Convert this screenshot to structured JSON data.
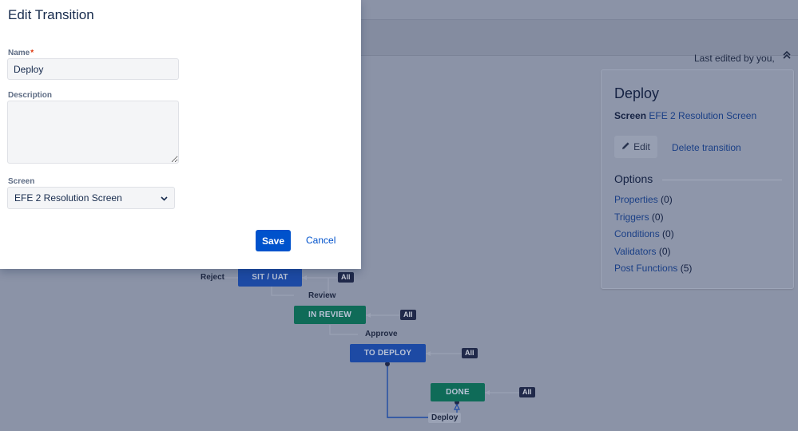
{
  "header": {
    "last_edited": "Last edited by you,"
  },
  "dialog": {
    "title": "Edit Transition",
    "name_label": "Name",
    "required_marker": "*",
    "name_value": "Deploy",
    "description_label": "Description",
    "description_value": "",
    "screen_label": "Screen",
    "screen_value": "EFE 2 Resolution Screen",
    "save_label": "Save",
    "cancel_label": "Cancel"
  },
  "workflow": {
    "statuses": {
      "sit_uat": "SIT / UAT",
      "in_review": "IN REVIEW",
      "to_deploy": "TO DEPLOY",
      "done": "DONE"
    },
    "all_badge": "All",
    "transitions": {
      "reject": "Reject",
      "review": "Review",
      "approve": "Approve",
      "deploy": "Deploy"
    }
  },
  "side_panel": {
    "title": "Deploy",
    "screen_label": "Screen",
    "screen_name": "EFE 2 Resolution Screen",
    "edit_label": "Edit",
    "delete_label": "Delete transition",
    "options_heading": "Options",
    "options": [
      {
        "label": "Properties",
        "count": "(0)"
      },
      {
        "label": "Triggers",
        "count": "(0)"
      },
      {
        "label": "Conditions",
        "count": "(0)"
      },
      {
        "label": "Validators",
        "count": "(0)"
      },
      {
        "label": "Post Functions",
        "count": "(5)"
      }
    ]
  },
  "colors": {
    "primary": "#0052cc",
    "status_blue": "#1d4aa4",
    "status_green": "#0f6b58"
  },
  "icons": {
    "edit": "pencil-icon",
    "collapse": "double-chevron-up-icon",
    "select": "chevron-down-icon"
  }
}
